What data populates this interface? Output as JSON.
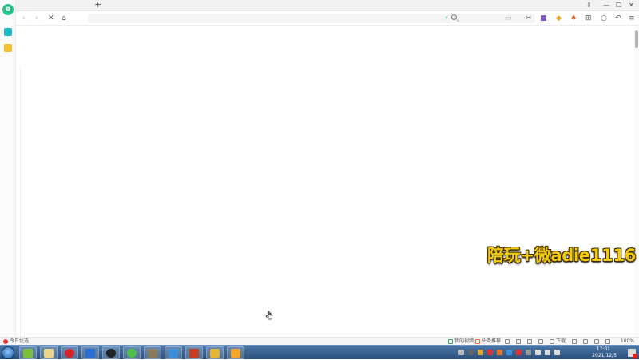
{
  "browser": {
    "new_tab_glyph": "+",
    "window_controls": [
      "⇩",
      "—",
      "❐",
      "✕"
    ],
    "nav": {
      "back": "‹",
      "forward": "›",
      "stop": "✕",
      "home": "⌂"
    },
    "address": {
      "value": "",
      "placeholder": ""
    },
    "search": {
      "value": "",
      "placeholder": ""
    },
    "toolbar_icons": [
      "scissors-icon",
      "extension-icon",
      "shield-icon",
      "game-icon",
      "apps-grid-icon",
      "refresh-icon",
      "undo-icon",
      "menu-icon"
    ]
  },
  "overlay_text": "陪玩+微adie1116",
  "status": {
    "news_label": "今日优选",
    "my_video": "我的视频",
    "hot_news": "头条推荐",
    "download": "下载",
    "zoom": "100%"
  },
  "taskbar": {
    "clock_time": "17:01",
    "clock_date": "2021/12/5",
    "apps": [
      "file-manager",
      "netease-music",
      "pin-app",
      "obs-studio",
      "green-app",
      "image-app",
      "blue-app",
      "game-app",
      "cat-app",
      "yellow-app"
    ]
  },
  "colors": {
    "brand": "#28c38a",
    "overlay": "#f3c90b",
    "taskbar": "#2b4f7c"
  }
}
